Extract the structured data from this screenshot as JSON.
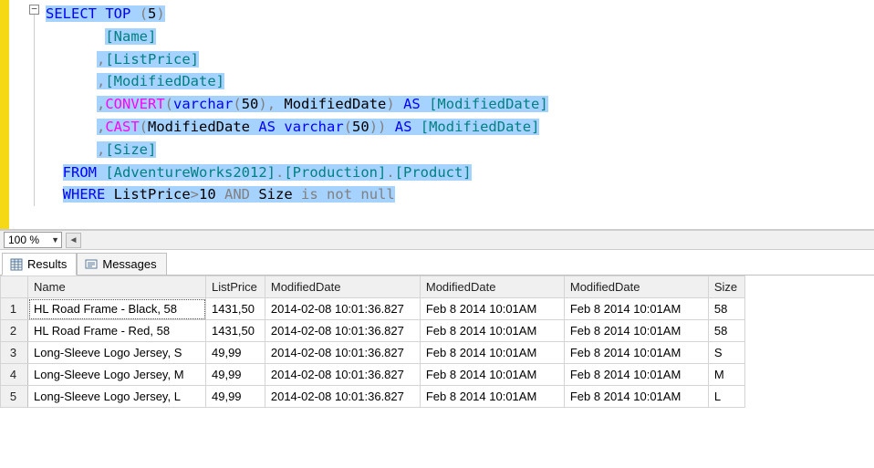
{
  "editor": {
    "fold_symbol": "−",
    "code_tokens": [
      [
        {
          "t": "SELECT",
          "c": "kw-blue",
          "hl": 1
        },
        {
          "t": " ",
          "hl": 1
        },
        {
          "t": "TOP",
          "c": "kw-blue",
          "hl": 1
        },
        {
          "t": " ",
          "hl": 1
        },
        {
          "t": "(",
          "c": "kw-gray",
          "hl": 1
        },
        {
          "t": "5",
          "hl": 1
        },
        {
          "t": ")",
          "c": "kw-gray",
          "hl": 1
        }
      ],
      [
        {
          "t": "       ",
          "hl": 0
        },
        {
          "t": "[Name]",
          "c": "ident",
          "hl": 1
        }
      ],
      [
        {
          "t": "      ",
          "hl": 0
        },
        {
          "t": ",",
          "c": "kw-gray",
          "hl": 1
        },
        {
          "t": "[ListPrice]",
          "c": "ident",
          "hl": 1
        }
      ],
      [
        {
          "t": "      ",
          "hl": 0
        },
        {
          "t": ",",
          "c": "kw-gray",
          "hl": 1
        },
        {
          "t": "[ModifiedDate]",
          "c": "ident",
          "hl": 1
        }
      ],
      [
        {
          "t": "      ",
          "hl": 0
        },
        {
          "t": ",",
          "c": "kw-gray",
          "hl": 1
        },
        {
          "t": "CONVERT",
          "c": "kw-magenta",
          "hl": 1
        },
        {
          "t": "(",
          "c": "kw-gray",
          "hl": 1
        },
        {
          "t": "varchar",
          "c": "kw-blue",
          "hl": 1
        },
        {
          "t": "(",
          "c": "kw-gray",
          "hl": 1
        },
        {
          "t": "50",
          "hl": 1
        },
        {
          "t": ")",
          "c": "kw-gray",
          "hl": 1
        },
        {
          "t": ",",
          "c": "kw-gray",
          "hl": 1
        },
        {
          "t": " ModifiedDate",
          "hl": 1
        },
        {
          "t": ")",
          "c": "kw-gray",
          "hl": 1
        },
        {
          "t": " ",
          "hl": 1
        },
        {
          "t": "AS",
          "c": "kw-blue",
          "hl": 1
        },
        {
          "t": " ",
          "hl": 1
        },
        {
          "t": "[ModifiedDate]",
          "c": "ident",
          "hl": 1
        }
      ],
      [
        {
          "t": "      ",
          "hl": 0
        },
        {
          "t": ",",
          "c": "kw-gray",
          "hl": 1
        },
        {
          "t": "CAST",
          "c": "kw-magenta",
          "hl": 1
        },
        {
          "t": "(",
          "c": "kw-gray",
          "hl": 1
        },
        {
          "t": "ModifiedDate ",
          "hl": 1
        },
        {
          "t": "AS",
          "c": "kw-blue",
          "hl": 1
        },
        {
          "t": " ",
          "hl": 1
        },
        {
          "t": "varchar",
          "c": "kw-blue",
          "hl": 1
        },
        {
          "t": "(",
          "c": "kw-gray",
          "hl": 1
        },
        {
          "t": "50",
          "hl": 1
        },
        {
          "t": ")",
          "c": "kw-gray",
          "hl": 1
        },
        {
          "t": ")",
          "c": "kw-gray",
          "hl": 1
        },
        {
          "t": " ",
          "hl": 1
        },
        {
          "t": "AS",
          "c": "kw-blue",
          "hl": 1
        },
        {
          "t": " ",
          "hl": 1
        },
        {
          "t": "[ModifiedDate]",
          "c": "ident",
          "hl": 1
        }
      ],
      [
        {
          "t": "      ",
          "hl": 0
        },
        {
          "t": ",",
          "c": "kw-gray",
          "hl": 1
        },
        {
          "t": "[Size]",
          "c": "ident",
          "hl": 1
        }
      ],
      [
        {
          "t": "  ",
          "hl": 0
        },
        {
          "t": "FROM",
          "c": "kw-blue",
          "hl": 1
        },
        {
          "t": " ",
          "hl": 1
        },
        {
          "t": "[AdventureWorks2012]",
          "c": "ident",
          "hl": 1
        },
        {
          "t": ".",
          "c": "kw-gray",
          "hl": 1
        },
        {
          "t": "[Production]",
          "c": "ident",
          "hl": 1
        },
        {
          "t": ".",
          "c": "kw-gray",
          "hl": 1
        },
        {
          "t": "[Product]",
          "c": "ident",
          "hl": 1
        }
      ],
      [
        {
          "t": "  ",
          "hl": 0
        },
        {
          "t": "WHERE",
          "c": "kw-blue",
          "hl": 1
        },
        {
          "t": " ListPrice",
          "hl": 1
        },
        {
          "t": ">",
          "c": "kw-gray",
          "hl": 1
        },
        {
          "t": "10 ",
          "hl": 1
        },
        {
          "t": "AND",
          "c": "kw-gray",
          "hl": 1
        },
        {
          "t": " Size ",
          "hl": 1
        },
        {
          "t": "is",
          "c": "kw-gray",
          "hl": 1
        },
        {
          "t": " ",
          "hl": 1
        },
        {
          "t": "not",
          "c": "kw-gray",
          "hl": 1
        },
        {
          "t": " ",
          "hl": 1
        },
        {
          "t": "null",
          "c": "kw-gray",
          "hl": 1
        }
      ]
    ]
  },
  "zoom": {
    "value": "100 %"
  },
  "tabs": {
    "results": "Results",
    "messages": "Messages"
  },
  "grid": {
    "columns": [
      "Name",
      "ListPrice",
      "ModifiedDate",
      "ModifiedDate",
      "ModifiedDate",
      "Size"
    ],
    "rows": [
      {
        "num": "1",
        "cells": [
          "HL Road Frame - Black, 58",
          "1431,50",
          "2014-02-08 10:01:36.827",
          "Feb  8 2014 10:01AM",
          "Feb  8 2014 10:01AM",
          "58"
        ]
      },
      {
        "num": "2",
        "cells": [
          "HL Road Frame - Red, 58",
          "1431,50",
          "2014-02-08 10:01:36.827",
          "Feb  8 2014 10:01AM",
          "Feb  8 2014 10:01AM",
          "58"
        ]
      },
      {
        "num": "3",
        "cells": [
          "Long-Sleeve Logo Jersey, S",
          "49,99",
          "2014-02-08 10:01:36.827",
          "Feb  8 2014 10:01AM",
          "Feb  8 2014 10:01AM",
          "S"
        ]
      },
      {
        "num": "4",
        "cells": [
          "Long-Sleeve Logo Jersey, M",
          "49,99",
          "2014-02-08 10:01:36.827",
          "Feb  8 2014 10:01AM",
          "Feb  8 2014 10:01AM",
          "M"
        ]
      },
      {
        "num": "5",
        "cells": [
          "Long-Sleeve Logo Jersey, L",
          "49,99",
          "2014-02-08 10:01:36.827",
          "Feb  8 2014 10:01AM",
          "Feb  8 2014 10:01AM",
          "L"
        ]
      }
    ]
  }
}
